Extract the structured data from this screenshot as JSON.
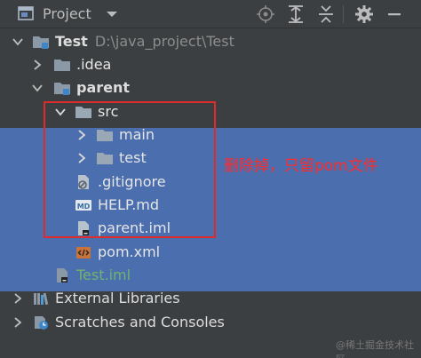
{
  "toolbar": {
    "title": "Project",
    "icons": [
      "project-window-icon",
      "dropdown-caret-icon",
      "locate-target-icon",
      "expand-all-icon",
      "collapse-all-icon",
      "settings-gear-icon",
      "hide-minus-icon"
    ]
  },
  "tree": {
    "root": {
      "name": "Test",
      "path": "D:\\java_project\\Test"
    },
    "idea": {
      "name": ".idea"
    },
    "parent": {
      "name": "parent"
    },
    "src": {
      "name": "src"
    },
    "main": {
      "name": "main"
    },
    "test": {
      "name": "test"
    },
    "gitignore": {
      "name": ".gitignore"
    },
    "help": {
      "name": "HELP.md"
    },
    "parent_iml": {
      "name": "parent.iml"
    },
    "pom": {
      "name": "pom.xml"
    },
    "test_iml": {
      "name": "Test.iml"
    },
    "ext_libs": {
      "name": "External Libraries"
    },
    "scratches": {
      "name": "Scratches and Consoles"
    }
  },
  "annotation": {
    "text": "删除掉，只留pom文件"
  },
  "watermark": {
    "text": "@稀土掘金技术社区"
  },
  "colors": {
    "background": "#3c3f41",
    "selection": "#4b6eaf",
    "annotation_red": "#e02b2b",
    "folder": "#8b98a6",
    "iml_green": "#6fb36f"
  }
}
